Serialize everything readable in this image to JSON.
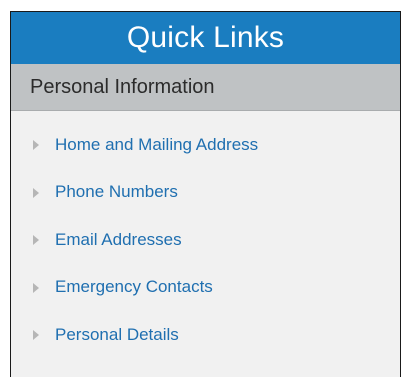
{
  "header": {
    "title": "Quick Links"
  },
  "section": {
    "title": "Personal Information"
  },
  "links": [
    {
      "label": "Home and Mailing Address"
    },
    {
      "label": "Phone Numbers"
    },
    {
      "label": "Email Addresses"
    },
    {
      "label": "Emergency Contacts"
    },
    {
      "label": "Personal Details"
    }
  ],
  "colors": {
    "header_bg": "#1a7dc0",
    "section_bg": "#bfc2c4",
    "link_text": "#1f6fb0",
    "arrow": "#b6b6b6"
  },
  "icons": {
    "link_bullet": "triangle-right-icon"
  }
}
